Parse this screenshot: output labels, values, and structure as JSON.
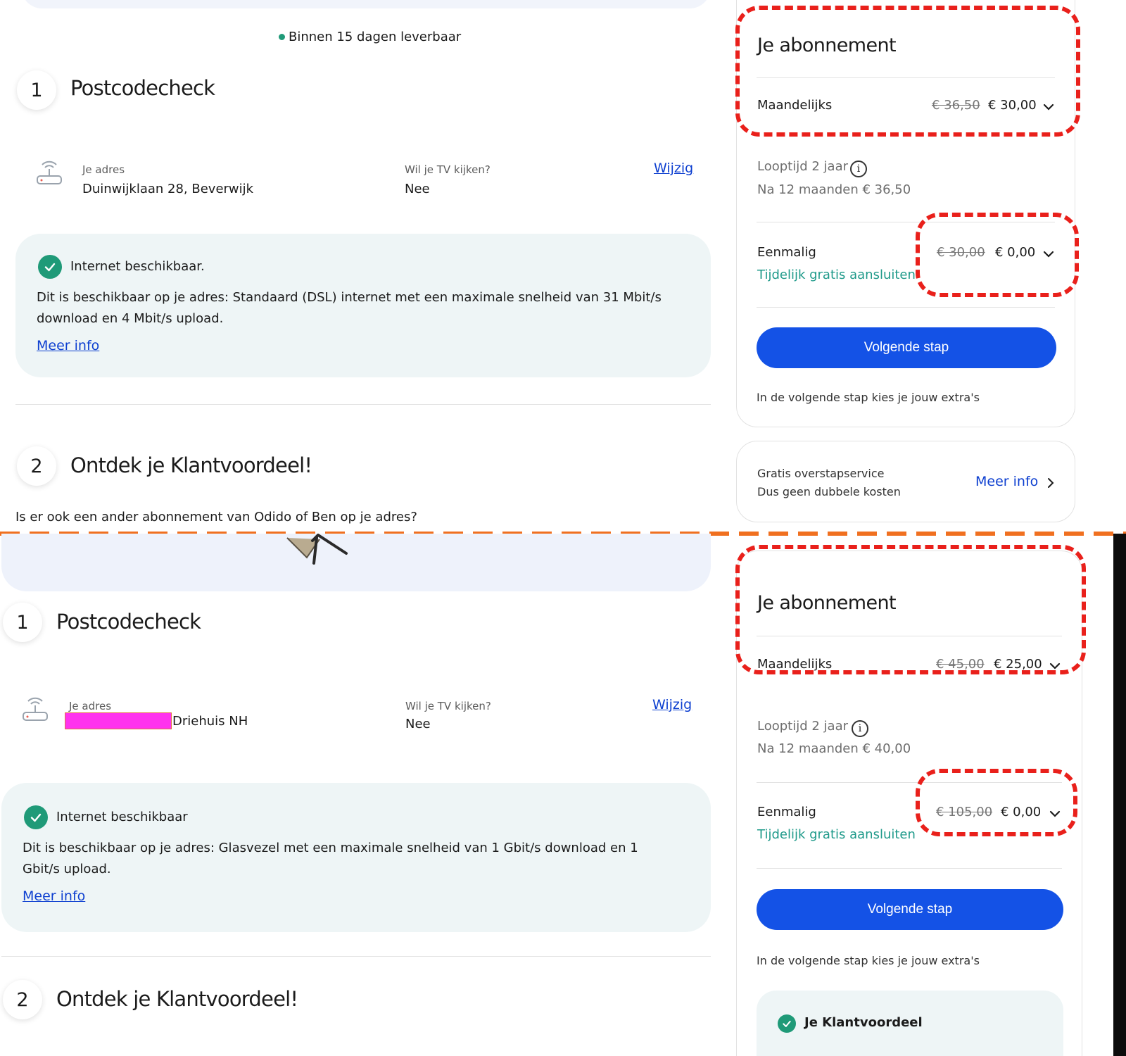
{
  "top": {
    "delivery_text": "Binnen 15 dagen leverbaar",
    "step1": {
      "number": "1",
      "title": "Postcodecheck"
    },
    "address": {
      "label": "Je adres",
      "value": "Duinwijklaan 28, Beverwijk"
    },
    "tv": {
      "label": "Wil je TV kijken?",
      "value": "Nee"
    },
    "change_link": "Wijzig",
    "availability": {
      "title": "Internet beschikbaar.",
      "description": "Dit is beschikbaar op je adres: Standaard (DSL) internet met een maximale snelheid van 31 Mbit/s download en 4 Mbit/s upload.",
      "more_info": "Meer info"
    },
    "step2": {
      "number": "2",
      "title": "Ontdek je Klantvoordeel!"
    },
    "question": "Is er ook een ander abonnement van Odido of Ben op je adres?",
    "card": {
      "title": "Je abonnement",
      "monthly_label": "Maandelijks",
      "monthly_old": "€ 36,50",
      "monthly_new": "€ 30,00",
      "term": "Looptijd 2 jaar",
      "after": "Na 12 maanden € 36,50",
      "once_label": "Eenmalig",
      "once_old": "€ 30,00",
      "once_new": "€ 0,00",
      "promo": "Tijdelijk gratis aansluiten",
      "cta": "Volgende stap",
      "note": "In de volgende stap kies je jouw extra's"
    },
    "switch_card": {
      "line1": "Gratis overstapservice",
      "line2": "Dus geen dubbele kosten",
      "link": "Meer info"
    }
  },
  "bottom": {
    "step1": {
      "number": "1",
      "title": "Postcodecheck"
    },
    "address": {
      "label": "Je adres",
      "value": "Driehuis NH"
    },
    "tv": {
      "label": "Wil je TV kijken?",
      "value": "Nee"
    },
    "change_link": "Wijzig",
    "availability": {
      "title": "Internet beschikbaar",
      "description": "Dit is beschikbaar op je adres: Glasvezel met een maximale snelheid van 1 Gbit/s download en 1 Gbit/s upload.",
      "more_info": "Meer info"
    },
    "step2": {
      "number": "2",
      "title": "Ontdek je Klantvoordeel!"
    },
    "card": {
      "title": "Je abonnement",
      "monthly_label": "Maandelijks",
      "monthly_old": "€ 45,00",
      "monthly_new": "€ 25,00",
      "term": "Looptijd 2 jaar",
      "after": "Na 12 maanden € 40,00",
      "once_label": "Eenmalig",
      "once_old": "€ 105,00",
      "once_new": "€ 0,00",
      "promo": "Tijdelijk gratis aansluiten",
      "cta": "Volgende stap",
      "note": "In de volgende stap kies je jouw extra's",
      "benefit": "Je Klantvoordeel"
    }
  },
  "colors": {
    "primary_button": "#1452e6",
    "success": "#1f9a78",
    "annotation_red": "#e9201b",
    "divider_orange": "#f07020",
    "redaction_magenta": "#ff33ee"
  }
}
